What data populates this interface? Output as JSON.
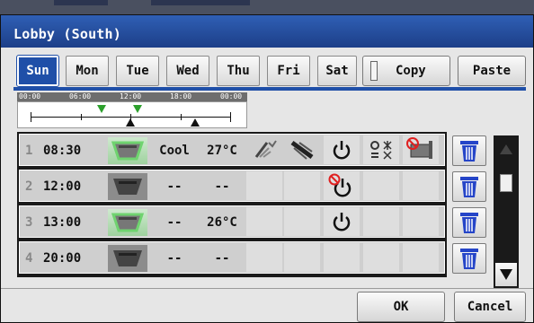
{
  "window": {
    "title": "Lobby (South)"
  },
  "tabs": [
    {
      "label": "Sun",
      "active": true
    },
    {
      "label": "Mon",
      "active": false
    },
    {
      "label": "Tue",
      "active": false
    },
    {
      "label": "Wed",
      "active": false
    },
    {
      "label": "Thu",
      "active": false
    },
    {
      "label": "Fri",
      "active": false
    },
    {
      "label": "Sat",
      "active": false
    }
  ],
  "actions": {
    "copy": "Copy",
    "paste": "Paste",
    "ok": "OK",
    "cancel": "Cancel"
  },
  "timeline": {
    "labels": [
      "00:00",
      "06:00",
      "12:00",
      "18:00",
      "00:00"
    ]
  },
  "schedule": [
    {
      "num": "1",
      "time": "08:30",
      "mode": "Cool",
      "temp": "27°C",
      "unit_state": "on"
    },
    {
      "num": "2",
      "time": "12:00",
      "mode": "--",
      "temp": "--",
      "unit_state": "off"
    },
    {
      "num": "3",
      "time": "13:00",
      "mode": "--",
      "temp": "26°C",
      "unit_state": "on"
    },
    {
      "num": "4",
      "time": "20:00",
      "mode": "--",
      "temp": "--",
      "unit_state": "off"
    }
  ],
  "colors": {
    "accent": "#1f4fa8",
    "title_bg": "#2f5fb5",
    "on_green": "#6fd36f",
    "trash_blue": "#2545c8"
  },
  "icons": [
    "fan-speed-icon",
    "air-direction-icon",
    "power-icon",
    "power-prohibited-icon",
    "local-operation-icon",
    "remote-prohibit-icon",
    "trash-icon",
    "scroll-up-icon",
    "scroll-down-icon"
  ]
}
